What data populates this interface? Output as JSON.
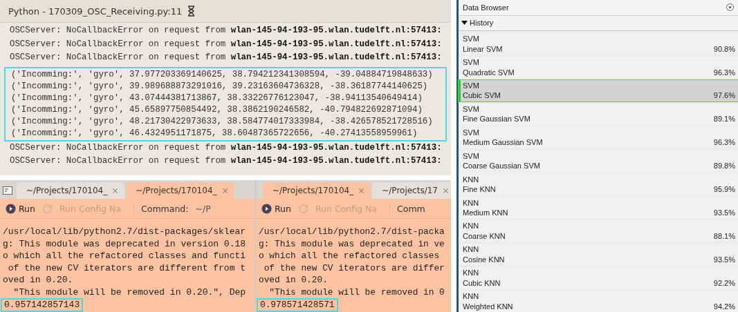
{
  "console": {
    "title": "Python - 170309_OSC_Receiving.py:11",
    "lines_before": [
      "OSCServer: NoCallbackError on request from **wlan-145-94-193-95.wlan.tudelft.nl:57413:**",
      "OSCServer: NoCallbackError on request from **wlan-145-94-193-95.wlan.tudelft.nl:57413:**",
      "OSCServer: NoCallbackError on request from **wlan-145-94-193-95.wlan.tudelft.nl:57413:**"
    ],
    "highlighted_lines": [
      "('Incomming:', 'gyro', 37.977203369140625, 38.794212341308594, -39.04884719848633)",
      "('Incomming:', 'gyro', 39.989688873291016, 39.23163604736328, -38.36187744140625)",
      "('Incomming:', 'gyro', 43.07444381713867, 38.33226776123047, -38.94113540649414)",
      "('Incomming:', 'gyro', 45.65897750854492, 38.3862190246582, -40.794822692871094)",
      "('Incomming:', 'gyro', 48.21730422973633, 38.584774017333984, -38.426578521728516)",
      "('Incomming:', 'gyro', 46.4324951171875, 38.60487365722656, -40.27413558959961)"
    ],
    "lines_after": [
      "OSCServer: NoCallbackError on request from **wlan-145-94-193-95.wlan.tudelft.nl:57413:**",
      "OSCServer: NoCallbackError on request from **wlan-145-94-193-95.wlan.tudelft.nl:57413:**"
    ]
  },
  "run_panes": [
    {
      "tabs": [
        {
          "label": "~/Projects/170104_",
          "selected": false
        },
        {
          "label": "~/Projects/170104_",
          "selected": true
        }
      ],
      "run": "Run",
      "config": "Run Config Na",
      "command": "Command:",
      "command_value": "~/P",
      "output": [
        "/usr/local/lib/python2.7/dist-packages/sklear",
        "g: This module was deprecated in version 0.18",
        "o which all the refactored classes and functi",
        " of the new CV iterators are different from t",
        "oved in 0.20.",
        "  \"This module will be removed in 0.20.\", Dep"
      ],
      "result": "0.957142857143"
    },
    {
      "tabs": [
        {
          "label": "~/Projects/170104_",
          "selected": true
        },
        {
          "label": "~/Projects/17",
          "selected": false
        }
      ],
      "run": "Run",
      "config": "Run Config Na",
      "command": "Comm",
      "output": [
        "/usr/local/lib/python2.7/dist-packa",
        "g: This module was deprecated in ve",
        "o which all the refactored classes",
        " of the new CV iterators are differ",
        "oved in 0.20.",
        "  \"This module will be removed in 0"
      ],
      "result": "0.978571428571"
    }
  ],
  "data_browser": {
    "title": "Data Browser",
    "section": "History",
    "expanded": true,
    "models": [
      {
        "group": "SVM",
        "name": "Linear SVM",
        "accuracy": "90.8%",
        "selected": false
      },
      {
        "group": "SVM",
        "name": "Quadratic SVM",
        "accuracy": "96.3%",
        "selected": false
      },
      {
        "group": "SVM",
        "name": "Cubic SVM",
        "accuracy": "97.6%",
        "selected": true
      },
      {
        "group": "SVM",
        "name": "Fine Gaussian SVM",
        "accuracy": "89.1%",
        "selected": false
      },
      {
        "group": "SVM",
        "name": "Medium Gaussian SVM",
        "accuracy": "96.3%",
        "selected": false
      },
      {
        "group": "SVM",
        "name": "Coarse Gaussian SVM",
        "accuracy": "89.8%",
        "selected": false
      },
      {
        "group": "KNN",
        "name": "Fine KNN",
        "accuracy": "95.9%",
        "selected": false
      },
      {
        "group": "KNN",
        "name": "Medium KNN",
        "accuracy": "93.5%",
        "selected": false
      },
      {
        "group": "KNN",
        "name": "Coarse KNN",
        "accuracy": "88.1%",
        "selected": false
      },
      {
        "group": "KNN",
        "name": "Cosine KNN",
        "accuracy": "93.5%",
        "selected": false
      },
      {
        "group": "KNN",
        "name": "Cubic KNN",
        "accuracy": "92.2%",
        "selected": false
      },
      {
        "group": "KNN",
        "name": "Weighted KNN",
        "accuracy": "94.2%",
        "selected": false
      }
    ]
  }
}
